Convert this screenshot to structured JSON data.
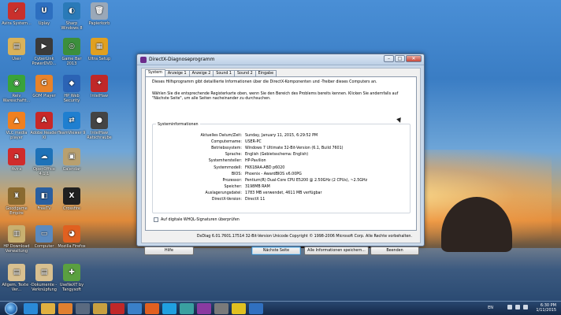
{
  "desktop_icons": [
    {
      "label": "Avira System...",
      "color": "#c9302c",
      "glyph": "✓"
    },
    {
      "label": "Uplay",
      "color": "#2d6fc0",
      "glyph": "U"
    },
    {
      "label": "Sharp Windows 8",
      "color": "#2a7ab8",
      "glyph": "◐"
    },
    {
      "label": "Papierkorb",
      "color": "#9aa8b8",
      "glyph": "🗑"
    },
    {
      "label": "User",
      "color": "#d9b25a",
      "glyph": "▤"
    },
    {
      "label": "CyberLink PowerDVD...",
      "color": "#3a3a3a",
      "glyph": "▶"
    },
    {
      "label": "Game Bar 2013",
      "color": "#3c8f3c",
      "glyph": "◎"
    },
    {
      "label": "Ultra Setup",
      "color": "#e0a020",
      "glyph": "▦"
    },
    {
      "label": "Reiv Wareschaftt...",
      "color": "#3aa33a",
      "glyph": "◉"
    },
    {
      "label": "GOM Player",
      "color": "#e8832a",
      "glyph": "G"
    },
    {
      "label": "HP Web Security",
      "color": "#2b63b5",
      "glyph": "◆"
    },
    {
      "label": "IntelHaw",
      "color": "#c02828",
      "glyph": "✦"
    },
    {
      "label": "VLC media player",
      "color": "#f08020",
      "glyph": "▲"
    },
    {
      "label": "Adobe Reader XI",
      "color": "#c82828",
      "glyph": "A"
    },
    {
      "label": "TeamViewer 9",
      "color": "#1f7fd0",
      "glyph": "⇄"
    },
    {
      "label": "IntelHaw Ratschraube",
      "color": "#444444",
      "glyph": "●"
    },
    {
      "label": "Avira",
      "color": "#d02c2c",
      "glyph": "a"
    },
    {
      "label": "OpenOffice 4.1.1",
      "color": "#1e72b8",
      "glyph": "☁"
    },
    {
      "label": "Calendar",
      "color": "#b8a070",
      "glyph": "▣"
    },
    {
      "label": "Goodgame Empire",
      "color": "#8a6a30",
      "glyph": "♜"
    },
    {
      "label": "FreeTV",
      "color": "#2a5fa0",
      "glyph": "◧"
    },
    {
      "label": "Crossfire",
      "color": "#202020",
      "glyph": "X"
    },
    {
      "label": "HP Download Verwaltung",
      "color": "#c8b070",
      "glyph": "▥"
    },
    {
      "label": "Computer",
      "color": "#5a8ac0",
      "glyph": "▭"
    },
    {
      "label": "Mozilla Firefox",
      "color": "#e06020",
      "glyph": "◕"
    },
    {
      "label": "Allgem. Texte - Ver...",
      "color": "#d8c090",
      "glyph": "▤"
    },
    {
      "label": "Dokumente - Verknüpfung",
      "color": "#d8c090",
      "glyph": "▤"
    },
    {
      "label": "UseNeXT by Tangysoft",
      "color": "#5aa040",
      "glyph": "✚"
    }
  ],
  "window": {
    "title": "DirectX-Diagnoseprogramm",
    "tabs": [
      "System",
      "Anzeige 1",
      "Anzeige 2",
      "Sound 1",
      "Sound 2",
      "Eingabe"
    ],
    "intro1": "Dieses Hilfsprogramm gibt detaillierte Informationen über die DirectX-Komponenten und -Treiber dieses Computers an.",
    "intro2": "Wählen Sie die entsprechende Registerkarte oben, wenn Sie den Bereich des Problems bereits kennen. Klicken Sie andernfalls auf \"Nächste Seite\", um alle Seiten nacheinander zu durchsuchen.",
    "group_title": "Systeminformationen",
    "rows": [
      {
        "label": "Aktuelles Datum/Zeit:",
        "value": "Sunday, January 11, 2015, 6:29:52 PM"
      },
      {
        "label": "Computername:",
        "value": "USER-PC"
      },
      {
        "label": "Betriebssystem:",
        "value": "Windows 7 Ultimate 32-Bit-Version (6.1, Build 7601)"
      },
      {
        "label": "Sprache:",
        "value": "English (Gebietsschema: English)"
      },
      {
        "label": "Systemhersteller:",
        "value": "HP-Pavilion"
      },
      {
        "label": "Systemmodell:",
        "value": "FK618AA-ABD p6020"
      },
      {
        "label": "BIOS:",
        "value": "Phoenix - AwardBIOS v6.00PG"
      },
      {
        "label": "Prozessor:",
        "value": "Pentium(R) Dual-Core  CPU      E5200  @ 2.50GHz (2 CPUs), ~2.5GHz"
      },
      {
        "label": "Speicher:",
        "value": "3198MB RAM"
      },
      {
        "label": "Auslagerungsdatei:",
        "value": "1783 MB verwendet, 4611 MB verfügbar"
      },
      {
        "label": "DirectX-Version:",
        "value": "DirectX 11"
      }
    ],
    "checkbox_label": "Auf digitale WHQL-Signaturen überprüfen",
    "footer": "DxDiag 6.01.7601.17514 32-Bit-Version Unicode Copyright © 1998-2006 Microsoft Corp. Alle Rechte vorbehalten.",
    "buttons": {
      "help": "Hilfe",
      "next": "Nächste Seite",
      "save": "Alle Informationen speichern...",
      "exit": "Beenden"
    }
  },
  "taskbar": {
    "language": "EN",
    "time": "6:30 PM",
    "date": "1/11/2015",
    "pinned": [
      {
        "name": "ie",
        "color": "#2a8ad8"
      },
      {
        "name": "explorer",
        "color": "#e0b040"
      },
      {
        "name": "media",
        "color": "#e08030"
      },
      {
        "name": "app1",
        "color": "#5a6a80"
      },
      {
        "name": "app2",
        "color": "#c8a040"
      },
      {
        "name": "app3",
        "color": "#c02828"
      },
      {
        "name": "app4",
        "color": "#3a80c8"
      },
      {
        "name": "firefox",
        "color": "#e06020"
      },
      {
        "name": "skype",
        "color": "#20a0e0"
      },
      {
        "name": "app5",
        "color": "#3aa0a0"
      },
      {
        "name": "directx",
        "color": "#8a3aa0"
      },
      {
        "name": "app6",
        "color": "#7a7a7a"
      },
      {
        "name": "xbox",
        "color": "#e0c020"
      },
      {
        "name": "app7",
        "color": "#3070c0"
      }
    ]
  }
}
